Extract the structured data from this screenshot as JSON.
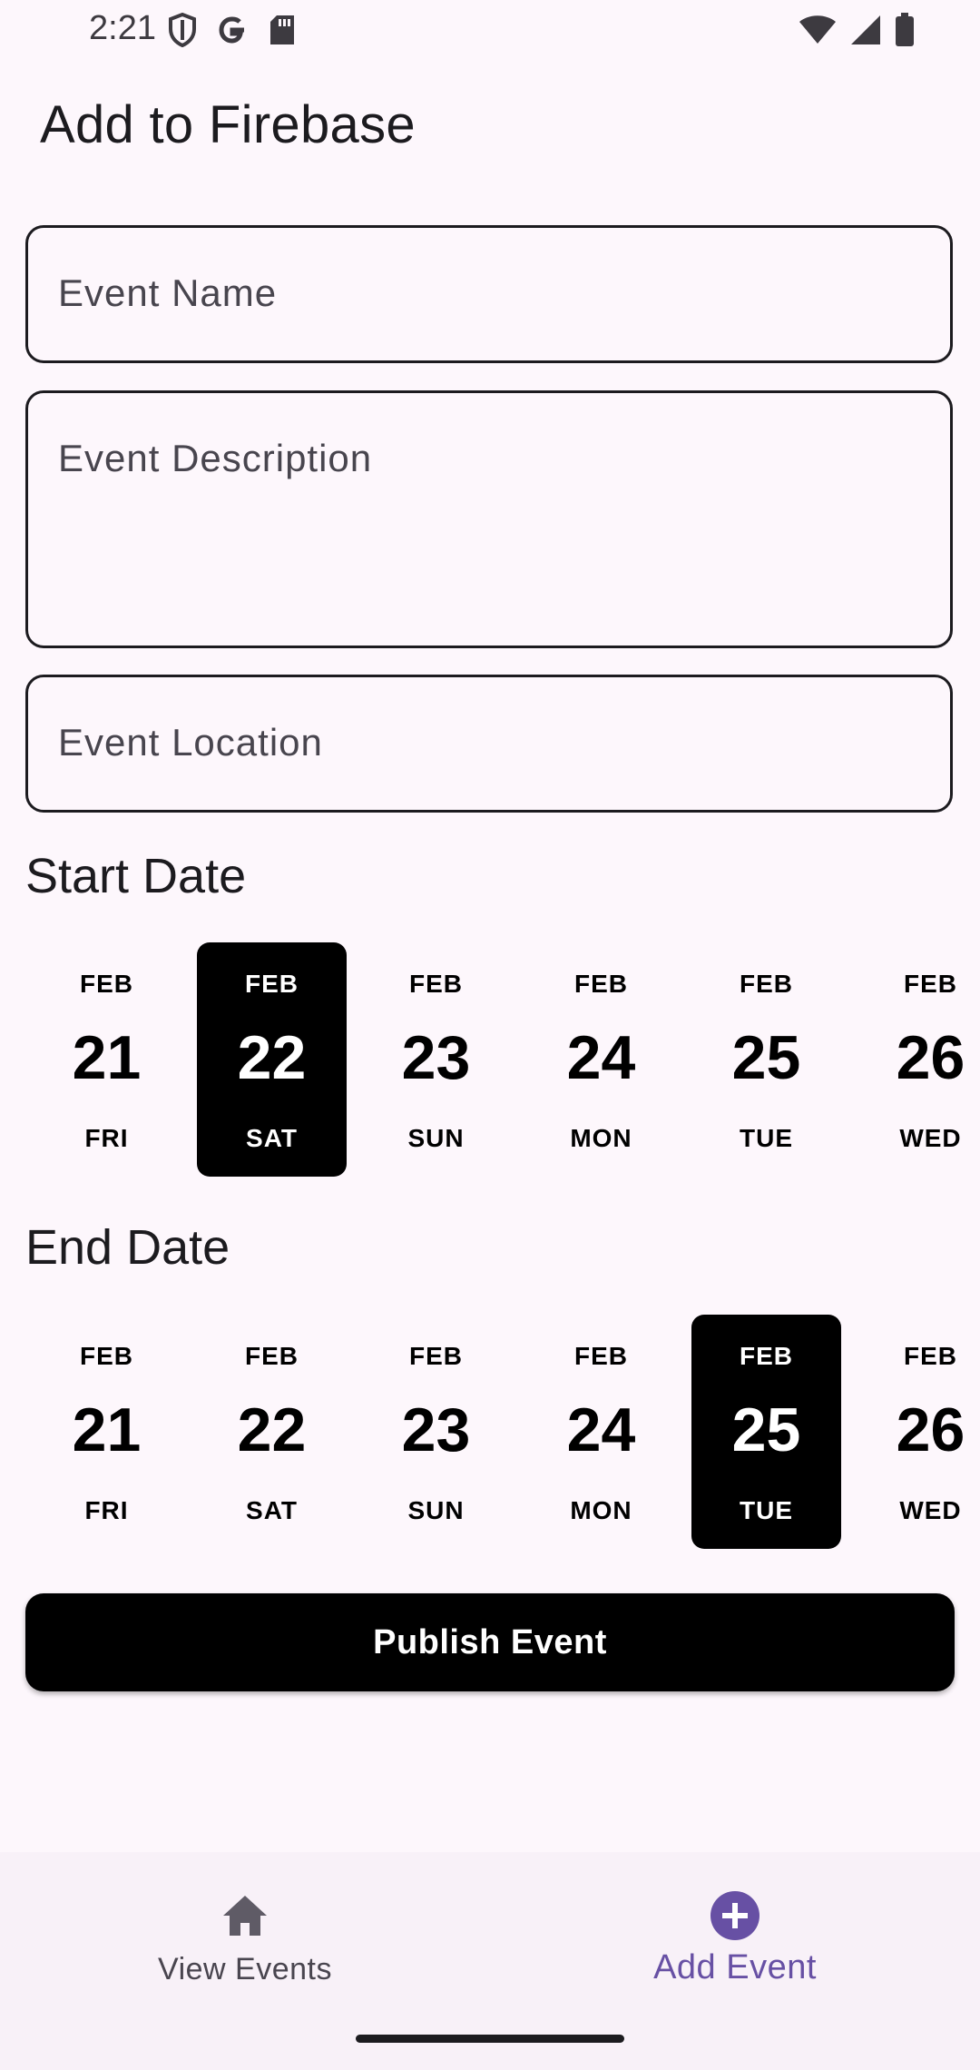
{
  "status_bar": {
    "time": "2:21",
    "left_icons": [
      "shield-icon",
      "google-icon",
      "sd-card-icon"
    ],
    "right_icons": [
      "wifi-icon",
      "signal-icon",
      "battery-icon"
    ]
  },
  "title": "Add to Firebase",
  "form": {
    "event_name_placeholder": "Event Name",
    "event_description_placeholder": "Event Description",
    "event_location_placeholder": "Event Location"
  },
  "start_date": {
    "label": "Start Date",
    "dates": [
      {
        "month": "FEB",
        "day": "21",
        "weekday": "FRI",
        "selected": false
      },
      {
        "month": "FEB",
        "day": "22",
        "weekday": "SAT",
        "selected": true
      },
      {
        "month": "FEB",
        "day": "23",
        "weekday": "SUN",
        "selected": false
      },
      {
        "month": "FEB",
        "day": "24",
        "weekday": "MON",
        "selected": false
      },
      {
        "month": "FEB",
        "day": "25",
        "weekday": "TUE",
        "selected": false
      },
      {
        "month": "FEB",
        "day": "26",
        "weekday": "WED",
        "selected": false
      }
    ]
  },
  "end_date": {
    "label": "End Date",
    "dates": [
      {
        "month": "FEB",
        "day": "21",
        "weekday": "FRI",
        "selected": false
      },
      {
        "month": "FEB",
        "day": "22",
        "weekday": "SAT",
        "selected": false
      },
      {
        "month": "FEB",
        "day": "23",
        "weekday": "SUN",
        "selected": false
      },
      {
        "month": "FEB",
        "day": "24",
        "weekday": "MON",
        "selected": false
      },
      {
        "month": "FEB",
        "day": "25",
        "weekday": "TUE",
        "selected": true
      },
      {
        "month": "FEB",
        "day": "26",
        "weekday": "WED",
        "selected": false
      }
    ]
  },
  "publish_label": "Publish Event",
  "bottom_nav": {
    "items": [
      {
        "label": "View Events",
        "icon": "home-icon",
        "active": false
      },
      {
        "label": "Add Event",
        "icon": "add-circle-icon",
        "active": true
      }
    ]
  },
  "colors": {
    "background": "#fdf7fc",
    "accent": "#6750a4",
    "selected_date": "#000000",
    "button": "#000000"
  }
}
